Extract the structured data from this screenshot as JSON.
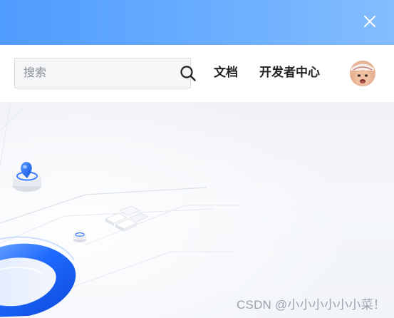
{
  "window": {
    "close_icon": "close-icon"
  },
  "header": {
    "search": {
      "placeholder": "搜索",
      "value": "",
      "icon": "search-icon"
    },
    "nav": {
      "docs_label": "文档",
      "developer_center_label": "开发者中心"
    },
    "avatar_icon": "user-avatar"
  },
  "colors": {
    "titlebar_start": "#4f9cff",
    "titlebar_end": "#84bdff",
    "accent_blue": "#1f6bff"
  },
  "watermark": {
    "text": "CSDN @小小小小小小菜！"
  }
}
